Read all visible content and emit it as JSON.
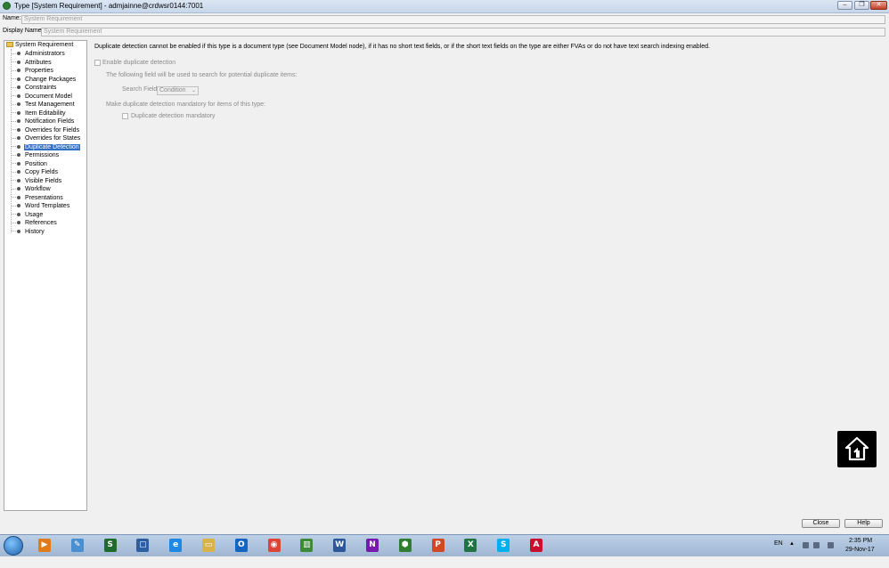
{
  "window": {
    "title": "Type  [System Requirement]   - admjainne@crdwsr0144:7001",
    "minimize_glyph": "–",
    "restore_glyph": "❐",
    "close_glyph": "✕"
  },
  "form": {
    "name_label": "Name:",
    "name_value": "System Requirement",
    "display_name_label": "Display Name:",
    "display_name_value": "System Requirement"
  },
  "tree": {
    "root_label": "System Requirement",
    "items": [
      {
        "label": "Administrators"
      },
      {
        "label": "Attributes"
      },
      {
        "label": "Properties"
      },
      {
        "label": "Change Packages"
      },
      {
        "label": "Constraints"
      },
      {
        "label": "Document Model"
      },
      {
        "label": "Test Management"
      },
      {
        "label": "Item Editability"
      },
      {
        "label": "Notification Fields"
      },
      {
        "label": "Overrides for Fields"
      },
      {
        "label": "Overrides for States"
      },
      {
        "label": "Duplicate Detection",
        "selected": true
      },
      {
        "label": "Permissions"
      },
      {
        "label": "Position"
      },
      {
        "label": "Copy Fields"
      },
      {
        "label": "Visible Fields"
      },
      {
        "label": "Workflow"
      },
      {
        "label": "Presentations"
      },
      {
        "label": "Word Templates"
      },
      {
        "label": "Usage"
      },
      {
        "label": "References"
      },
      {
        "label": "History"
      }
    ]
  },
  "content": {
    "notice": "Duplicate detection cannot be enabled if this type is a document type (see Document Model node), if it has no short text fields, or if the short text fields on the type are either FVAs or do not have text search indexing enabled.",
    "enable_label": "Enable duplicate detection",
    "enable_checked": false,
    "field_hint": "The following field will be used to search for potential duplicate items:",
    "search_field_label": "Search Field",
    "search_field_value": "Condition",
    "mandatory_hint": "Make duplicate detection mandatory for items of this type:",
    "mandatory_label": "Duplicate detection mandatory",
    "mandatory_checked": false
  },
  "buttons": {
    "close": "Close",
    "help": "Help"
  },
  "taskbar": {
    "apps": [
      {
        "name": "media-player-icon",
        "glyph": "▶",
        "color": "#e07a1a"
      },
      {
        "name": "paint-icon",
        "glyph": "✎",
        "color": "#4a8fd0"
      },
      {
        "name": "app-s-icon",
        "glyph": "S",
        "color": "#1f6b2d"
      },
      {
        "name": "virtualbox-icon",
        "glyph": "▢",
        "color": "#2d5fa0"
      },
      {
        "name": "internet-explorer-icon",
        "glyph": "e",
        "color": "#1e88e5"
      },
      {
        "name": "file-explorer-icon",
        "glyph": "▭",
        "color": "#d9b24a"
      },
      {
        "name": "outlook-icon",
        "glyph": "O",
        "color": "#1565c0"
      },
      {
        "name": "chrome-icon",
        "glyph": "◉",
        "color": "#db4437"
      },
      {
        "name": "project-chart-icon",
        "glyph": "▥",
        "color": "#3d8b37"
      },
      {
        "name": "word-icon",
        "glyph": "W",
        "color": "#2b579a"
      },
      {
        "name": "onenote-icon",
        "glyph": "N",
        "color": "#7719aa"
      },
      {
        "name": "integrity-client-icon",
        "glyph": "⬢",
        "color": "#2e7d32"
      },
      {
        "name": "powerpoint-icon",
        "glyph": "P",
        "color": "#d24726"
      },
      {
        "name": "excel-icon",
        "glyph": "X",
        "color": "#217346"
      },
      {
        "name": "skype-icon",
        "glyph": "S",
        "color": "#00aff0"
      },
      {
        "name": "acrobat-icon",
        "glyph": "A",
        "color": "#c8102e"
      }
    ],
    "language": "EN",
    "time": "2:35 PM",
    "date": "29-Nov-17"
  }
}
